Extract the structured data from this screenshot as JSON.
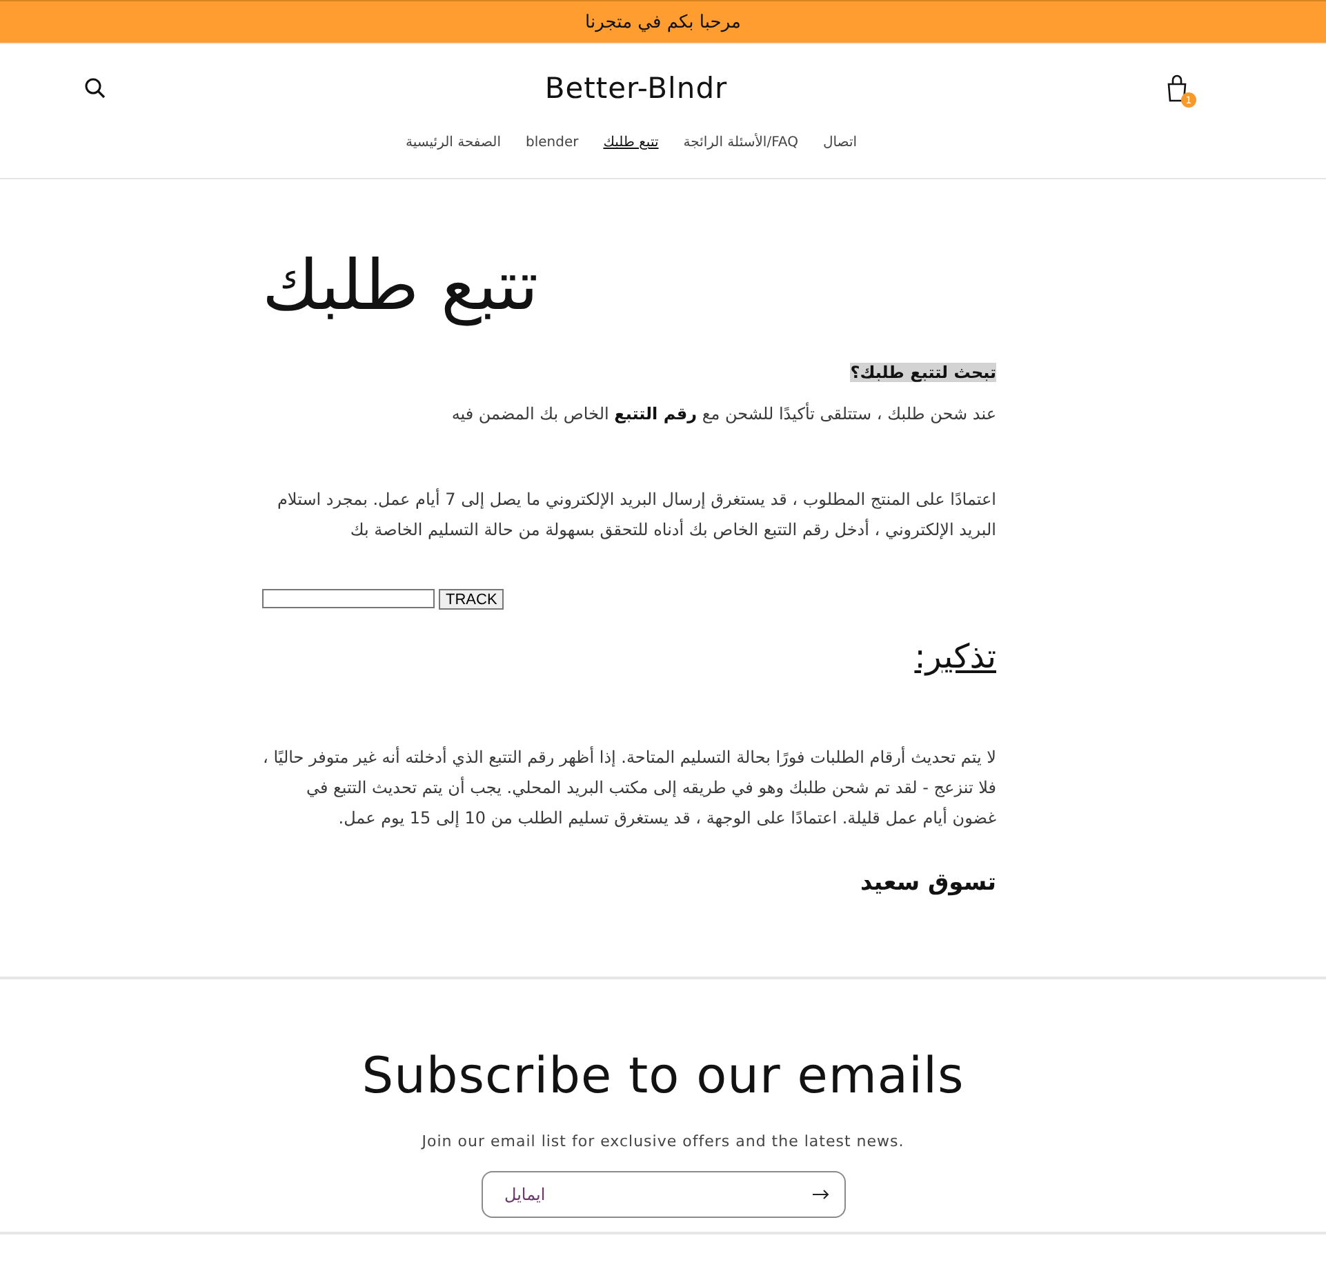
{
  "announcement": "مرحبا بكم في متجرنا",
  "header": {
    "logo": "Better-Blndr",
    "cart_count": "1"
  },
  "nav": [
    {
      "label": "اتصال",
      "selected": false
    },
    {
      "label": "الأسئلة الرائجة/FAQ",
      "selected": false
    },
    {
      "label": "تتبع طلبك",
      "selected": true
    },
    {
      "label": "blender",
      "selected": false
    },
    {
      "label": "الصفحة الرئيسية",
      "selected": false
    }
  ],
  "page": {
    "title": "تتبع طلبك",
    "blocks": [
      {
        "kind": "highlight",
        "text": "تبحث لتتبع طلبك؟"
      },
      {
        "kind": "paragraph",
        "text": "عند شحن طلبك ، ستتلقى تأكيدًا للشحن مع **رقم التتبع** الخاص بك المضمن فيه"
      },
      {
        "kind": "paragraph",
        "text": "اعتمادًا على المنتج المطلوب ، قد يستغرق إرسال البريد الإلكتروني ما يصل إلى 7 أيام عمل. بمجرد استلام البريد الإلكتروني ، أدخل رقم التتبع الخاص بك أدناه للتحقق بسهولة من حالة التسليم الخاصة بك"
      },
      {
        "kind": "tracker",
        "button": "TRACK"
      },
      {
        "kind": "heading",
        "text": "تذكير:"
      },
      {
        "kind": "paragraph",
        "text": "لا يتم تحديث أرقام الطلبات فورًا بحالة التسليم المتاحة. إذا أظهر رقم التتبع الذي أدخلته أنه غير متوفر حاليًا ، فلا تنزعج - لقد تم شحن طلبك وهو في طريقه إلى مكتب البريد المحلي. يجب أن يتم تحديث التتبع في غضون أيام عمل قليلة. اعتمادًا على الوجهة ، قد يستغرق تسليم الطلب من 10 إلى 15 يوم عمل."
      },
      {
        "kind": "closing",
        "text": "تسوق سعيد"
      }
    ]
  },
  "newsletter": {
    "title": "Subscribe to our emails",
    "subtitle": "Join our email list for exclusive offers and the latest news.",
    "placeholder": "ايمايل"
  }
}
